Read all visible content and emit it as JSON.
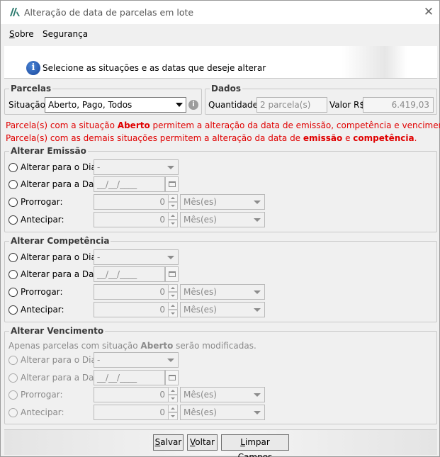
{
  "window": {
    "title": "Alteração de data de parcelas em lote",
    "close_symbol": "✕"
  },
  "menu": {
    "sobre_first": "S",
    "sobre_rest": "obre",
    "seguranca": "Segurança"
  },
  "banner": {
    "icon": "info-icon",
    "text": "Selecione as situações e as datas que deseje alterar"
  },
  "parcelas": {
    "legend": "Parcelas",
    "situacao_label": "Situação:",
    "situacao_value": "Aberto, Pago, Todos",
    "help_symbol": "i"
  },
  "dados": {
    "legend": "Dados",
    "quantidade_label": "Quantidade:",
    "quantidade_value": "2 parcela(s)",
    "valor_label": "Valor R$:",
    "valor_value": "6.419,03"
  },
  "messages": {
    "line1_a": "Parcela(s) com a situação ",
    "line1_b": "Aberto",
    "line1_c": " permitem a alteração da data de emissão, competência e vencimento.",
    "line2_a": "Parcela(s) com as demais situações permitem a alteração da data de ",
    "line2_b": "emissão",
    "line2_c": " e ",
    "line2_d": "competência",
    "line2_e": "."
  },
  "sections": {
    "emissao": {
      "legend": "Alterar Emissão",
      "opt_dia": "Alterar para o Dia:",
      "opt_data": "Alterar para a Data:",
      "opt_prorrogar": "Prorrogar:",
      "opt_antecipar": "Antecipar:",
      "dia_value": "-",
      "data_value": "__/__/____",
      "prorrogar_value": "0",
      "antecipar_value": "0",
      "unit": "Mês(es)"
    },
    "competencia": {
      "legend": "Alterar Competência",
      "opt_dia": "Alterar para o Dia:",
      "opt_data": "Alterar para a Data:",
      "opt_prorrogar": "Prorrogar:",
      "opt_antecipar": "Antecipar:",
      "dia_value": "-",
      "data_value": "__/__/____",
      "prorrogar_value": "0",
      "antecipar_value": "0",
      "unit": "Mês(es)"
    },
    "vencimento": {
      "legend": "Alterar Vencimento",
      "hint_a": "Apenas parcelas com situação ",
      "hint_b": "Aberto",
      "hint_c": " serão modificadas.",
      "opt_dia": "Alterar para o Dia:",
      "opt_data": "Alterar para a Data:",
      "opt_prorrogar": "Prorrogar:",
      "opt_antecipar": "Antecipar:",
      "dia_value": "-",
      "data_value": "__/__/____",
      "prorrogar_value": "0",
      "antecipar_value": "0",
      "unit": "Mês(es)"
    }
  },
  "buttons": {
    "salvar_first": "S",
    "salvar_rest": "alvar",
    "voltar_first": "V",
    "voltar_rest": "oltar",
    "limpar_first": "L",
    "limpar_rest": "impar Campos"
  }
}
